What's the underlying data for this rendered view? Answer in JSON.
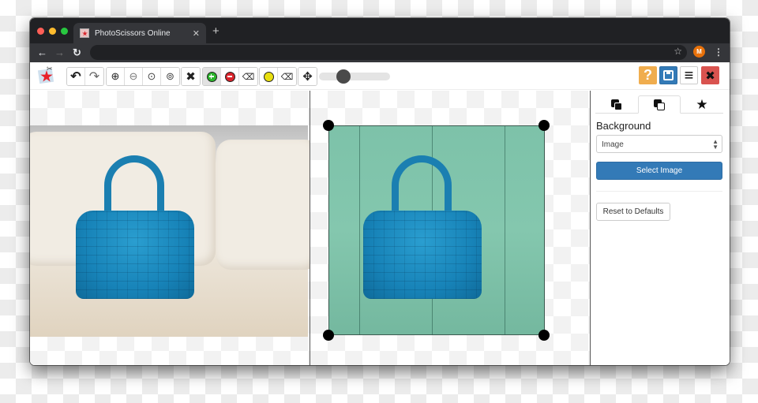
{
  "browser": {
    "tab_title": "PhotoScissors Online",
    "tab_close": "✕",
    "new_tab": "+",
    "back": "←",
    "forward": "→",
    "reload": "↻",
    "bookmark": "☆",
    "profile_initial": "M",
    "menu": "⋮",
    "traffic_lights": [
      "#ff5f57",
      "#febc2e",
      "#28c840"
    ]
  },
  "toolbar": {
    "undo": "↶",
    "redo": "↷",
    "zoom_in": "⊕",
    "zoom_out": "⊖",
    "zoom_actual": "⊙",
    "zoom_fit": "⊚",
    "clear": "✖",
    "eraser": "⌫",
    "move": "✥",
    "brush_size_fraction": 0.3,
    "help": "?",
    "save": "💾",
    "menu": "≡",
    "close": "✖",
    "colors": {
      "help_bg": "#f0ad4e",
      "save_bg": "#337ab7",
      "close_bg": "#d9534f"
    }
  },
  "sidebar": {
    "tabs": [
      {
        "name": "foreground",
        "icon": "layers-filled-icon"
      },
      {
        "name": "background",
        "icon": "layers-outline-icon",
        "active": true
      },
      {
        "name": "effects",
        "icon": "star-icon",
        "glyph": "★"
      }
    ],
    "section_title": "Background",
    "background_type": "Image",
    "select_caret": "⇕",
    "select_image_label": "Select Image",
    "reset_label": "Reset to Defaults"
  }
}
